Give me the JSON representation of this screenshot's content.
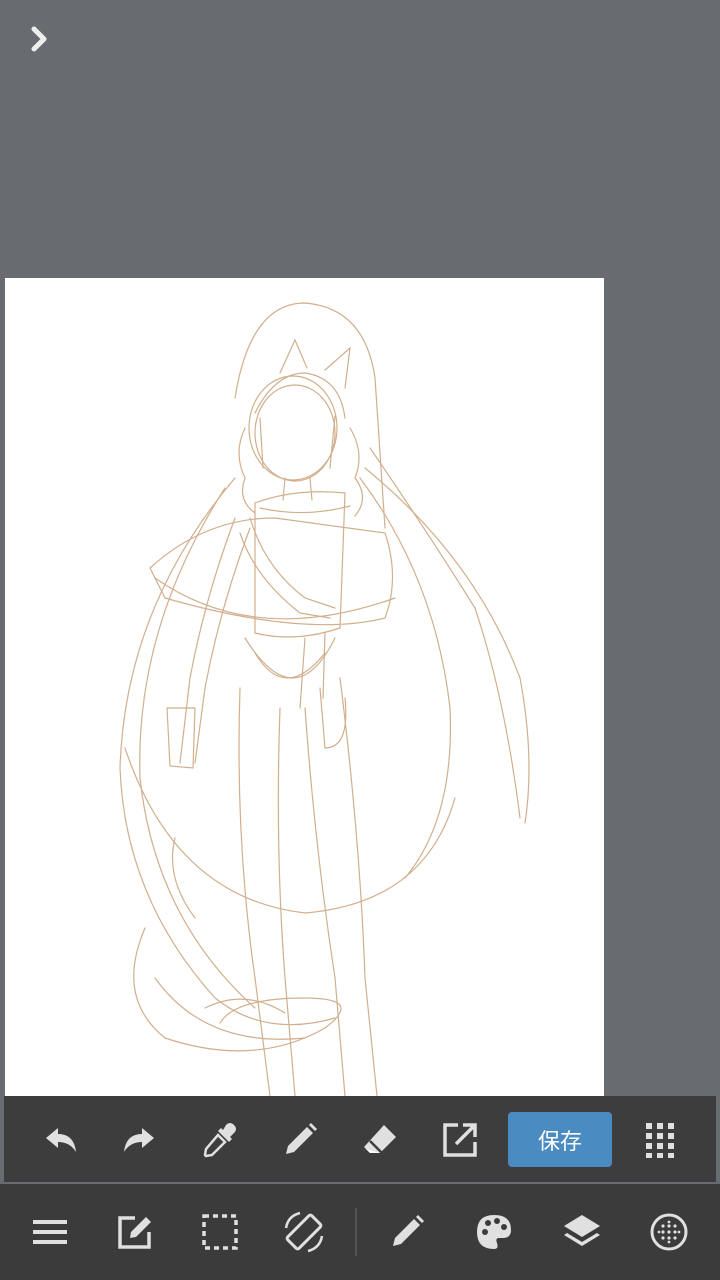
{
  "colors": {
    "workspace_bg": "#686b70",
    "canvas_bg": "#ffffff",
    "sketch_line": "#c9a27a",
    "toolbar_bg": "#3d3d3d",
    "icon": "#e0e0e0",
    "save_bg": "#4a8bc1"
  },
  "top_toolbar": {
    "icons": [
      "undo-icon",
      "redo-icon",
      "eyedropper-icon",
      "pen-icon",
      "eraser-icon",
      "external-link-icon",
      "grid-dots-icon"
    ],
    "save_label": "保存"
  },
  "bottom_toolbar": {
    "icons": [
      "menu-icon",
      "edit-icon",
      "selection-icon",
      "rotate-screen-icon",
      "brush-icon",
      "palette-icon",
      "layers-icon",
      "material-icon"
    ]
  }
}
